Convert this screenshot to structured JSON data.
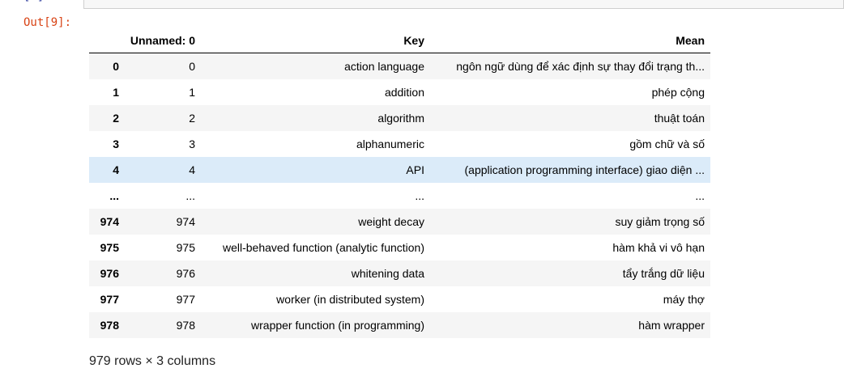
{
  "input_prompt": "[ ]",
  "output_prompt": "Out[9]:",
  "table": {
    "columns": [
      "",
      "Unnamed: 0",
      "Key",
      "Mean"
    ],
    "rows": [
      {
        "index": "0",
        "unnamed": "0",
        "key": "action language",
        "mean": "ngôn ngữ dùng để xác định sự thay đổi trạng th..."
      },
      {
        "index": "1",
        "unnamed": "1",
        "key": "addition",
        "mean": "phép cộng"
      },
      {
        "index": "2",
        "unnamed": "2",
        "key": "algorithm",
        "mean": "thuật toán"
      },
      {
        "index": "3",
        "unnamed": "3",
        "key": "alphanumeric",
        "mean": "gồm chữ và số"
      },
      {
        "index": "4",
        "unnamed": "4",
        "key": "API",
        "mean": "(application programming interface) giao diện ..."
      },
      {
        "index": "...",
        "unnamed": "...",
        "key": "...",
        "mean": "..."
      },
      {
        "index": "974",
        "unnamed": "974",
        "key": "weight decay",
        "mean": "suy giảm trọng số"
      },
      {
        "index": "975",
        "unnamed": "975",
        "key": "well-behaved function (analytic function)",
        "mean": "hàm khả vi vô hạn"
      },
      {
        "index": "976",
        "unnamed": "976",
        "key": "whitening data",
        "mean": "tẩy trắng dữ liệu"
      },
      {
        "index": "977",
        "unnamed": "977",
        "key": "worker (in distributed system)",
        "mean": "máy thợ"
      },
      {
        "index": "978",
        "unnamed": "978",
        "key": "wrapper function (in programming)",
        "mean": "hàm wrapper"
      }
    ],
    "hover_row": 4
  },
  "summary": "979 rows × 3 columns",
  "colors": {
    "out_prompt": "#d84315",
    "row_stripe": "#f5f5f5",
    "row_hover": "#dbebf9"
  }
}
